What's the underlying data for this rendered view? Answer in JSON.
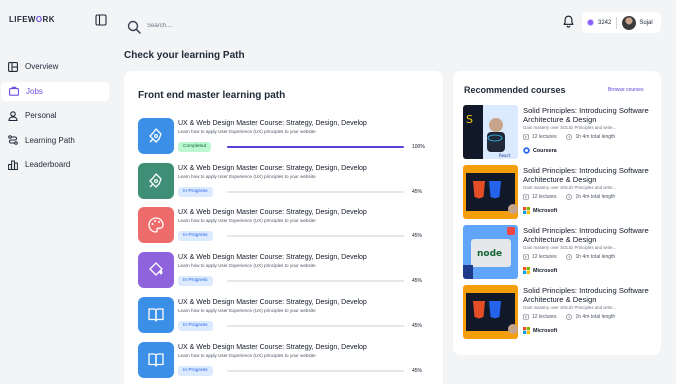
{
  "app": {
    "logo_part1": "LIFEW",
    "logo_part2": "O",
    "logo_part3": "RK"
  },
  "sidebar": {
    "items": [
      {
        "label": "Overview",
        "icon": "overview-icon",
        "active": false
      },
      {
        "label": "Jobs",
        "icon": "briefcase-icon",
        "active": true
      },
      {
        "label": "Personal",
        "icon": "person-icon",
        "active": false
      },
      {
        "label": "Learning Path",
        "icon": "path-icon",
        "active": false
      },
      {
        "label": "Leaderboard",
        "icon": "leaderboard-icon",
        "active": false
      }
    ]
  },
  "header": {
    "search_placeholder": "Search....",
    "coins": "3242",
    "user_name": "Sujal"
  },
  "page_title": "Check your learning Path",
  "learning_path": {
    "title": "Front end master learning path",
    "courses": [
      {
        "title": "UX & Web Design Master Course: Strategy, Design, Develop",
        "subtitle": "Learn how to apply User Experience (UX) principles to your website",
        "status": "Completed",
        "progress": 100,
        "percent_label": "100%",
        "color": "#3b8fe6",
        "icon": "pen-nib-icon"
      },
      {
        "title": "UX & Web Design Master Course: Strategy, Design, Develop",
        "subtitle": "Learn how to apply User Experience (UX) principles to your website",
        "status": "In Progress",
        "progress": 45,
        "percent_label": "45%",
        "color": "#3f8f77",
        "icon": "pen-nib-icon"
      },
      {
        "title": "UX & Web Design Master Course: Strategy, Design, Develop",
        "subtitle": "Learn how to apply User Experience (UX) principles to your website",
        "status": "In Progress",
        "progress": 45,
        "percent_label": "45%",
        "color": "#ee6b6b",
        "icon": "palette-icon"
      },
      {
        "title": "UX & Web Design Master Course: Strategy, Design, Develop",
        "subtitle": "Learn how to apply User Experience (UX) principles to your website",
        "status": "In Progress",
        "progress": 45,
        "percent_label": "45%",
        "color": "#8f63dc",
        "icon": "paint-bucket-icon"
      },
      {
        "title": "UX & Web Design Master Course: Strategy, Design, Develop",
        "subtitle": "Learn how to apply User Experience (UX) principles to your website",
        "status": "In Progress",
        "progress": 45,
        "percent_label": "45%",
        "color": "#3b8fe6",
        "icon": "book-icon"
      },
      {
        "title": "UX & Web Design Master Course: Strategy, Design, Develop",
        "subtitle": "Learn how to apply User Experience (UX) principles to your website",
        "status": "In Progress",
        "progress": 45,
        "percent_label": "45%",
        "color": "#3b8fe6",
        "icon": "book-icon"
      }
    ]
  },
  "recommended": {
    "title": "Recommended courses",
    "browse_label": "Browse courses",
    "items": [
      {
        "title": "Solid Principles: Introducing Software Architecture & Design",
        "subtitle": "Gain mastery over SOLID Principles and write...",
        "lectures": "12 lectures",
        "length": "1h 4m total length",
        "provider": "Coursera",
        "thumb": "react-thumbnail"
      },
      {
        "title": "Solid Principles: Introducing Software Architecture & Design",
        "subtitle": "Gain mastery over SOLID Principles and write...",
        "lectures": "12 lectures",
        "length": "1h 4m total length",
        "provider": "Microsoft",
        "thumb": "html-css-thumbnail"
      },
      {
        "title": "Solid Principles: Introducing Software Architecture & Design",
        "subtitle": "Gain mastery over SOLID Principles and write...",
        "lectures": "12 lectures",
        "length": "1h 4m total length",
        "provider": "Microsoft",
        "thumb": "node-thumbnail"
      },
      {
        "title": "Solid Principles: Introducing Software Architecture & Design",
        "subtitle": "Gain mastery over SOLID Principles and write...",
        "lectures": "12 lectures",
        "length": "1h 4m total length",
        "provider": "Microsoft",
        "thumb": "html-css-thumbnail"
      }
    ]
  }
}
